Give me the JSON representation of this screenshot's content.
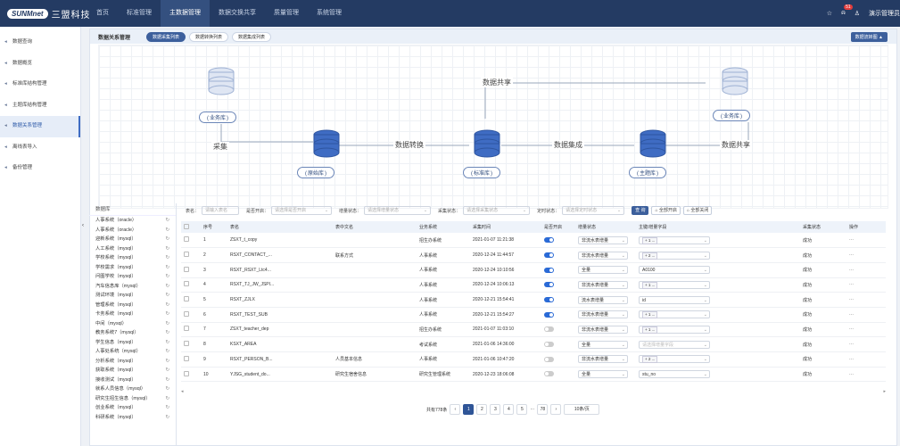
{
  "topbar": {
    "logo_mark": "SUNMnet",
    "logo_name": "三盟科技",
    "nav": [
      "首页",
      "标准管理",
      "主数据管理",
      "数据交换共享",
      "质量管理",
      "系统管理"
    ],
    "active": 2,
    "star_icon": "☆",
    "bell_icon": "🔔",
    "badge": "51",
    "user": "演示管理员"
  },
  "sidebar": {
    "items": [
      "数据查询",
      "数据概览",
      "标准库结构管理",
      "主题库结构管理",
      "数据关系管理",
      "离线表导入",
      "备份管理"
    ],
    "active": 4,
    "collapse": "‹"
  },
  "page": {
    "title": "数据关系管理",
    "tabs": [
      "数据采集列表",
      "数据转换列表",
      "数据集成列表"
    ],
    "active_tab": 0,
    "toggle": "数据流转图 ▲"
  },
  "diagram": {
    "nodes": {
      "biz_left": "业务库",
      "raw": "原始库",
      "std": "标准库",
      "topic": "主题库",
      "biz_right": "业务库"
    },
    "edges": {
      "collect": "采集",
      "convert": "数据转换",
      "share_top": "数据共享",
      "integrate": "数据集成",
      "share_right": "数据共享"
    }
  },
  "dblist": {
    "header": "数据库",
    "items": [
      "人事系统（oracle）",
      "人事系统（oracle）",
      "迎新系统（mysql）",
      "人工系统（mysql）",
      "学校系统（mysql）",
      "学校需求（mysql）",
      "问图学校（mysql）",
      "汽车信息库（mysql）",
      "测试环境（mysql）",
      "管理系统（mysql）",
      "卡务系统（mysql）",
      "中间（mysql）",
      "教务系统7（mysql）",
      "学生信息（mysql）",
      "人事处系统（mysql）",
      "分析系统（mysql）",
      "获取系统（mysql）",
      "接收测试（mysql）",
      "就系人员信息（mysql）",
      "研究生招生信息（mysql）",
      "创业系统（mysql）",
      "科研系统（mysql）"
    ]
  },
  "filters": {
    "table_label": "表名：",
    "table_ph": "请输入表名",
    "open_label": "是否开启：",
    "open_ph": "请选择是否开启",
    "sync_label": "增量状态：",
    "sync_ph": "请选择增量状态",
    "collect_label": "采集状态：",
    "collect_ph": "请选择采集状态",
    "timer_label": "定时状态：",
    "timer_ph": "请选择定时状态",
    "search": "查 询",
    "all_on": "全部开启",
    "all_off": "全部关闭"
  },
  "table": {
    "headers": [
      "序号",
      "表名",
      "表中文名",
      "业务系统",
      "采集时间",
      "是否开启",
      "增量状态",
      "主键/增量字段",
      "采集状态",
      "操作"
    ],
    "rows": [
      [
        "1",
        "ZSXT_t_copy",
        "",
        "招生办系统",
        "2021-01-07 11:21:38",
        true,
        "非流水表增量",
        "+ 1 ...",
        "成功",
        "⋯"
      ],
      [
        "2",
        "RSXT_CONTACT_...",
        "联系方式",
        "人事系统",
        "2020-12-24 11:44:57",
        true,
        "非流水表增量",
        "+ 2 ...",
        "成功",
        "⋯"
      ],
      [
        "3",
        "RSXT_RSXT_Ltc4...",
        "",
        "人事系统",
        "2020-12-24 10:10:56",
        true,
        "全量",
        "A0100",
        "成功",
        "⋯"
      ],
      [
        "4",
        "RSXT_TJ_JW_JSPI...",
        "",
        "人事系统",
        "2020-12-24 10:06:13",
        true,
        "非流水表增量",
        "+ 1 ...",
        "成功",
        "⋯"
      ],
      [
        "5",
        "RSXT_ZJLX",
        "",
        "人事系统",
        "2020-12-21 15:54:41",
        true,
        "流水表增量",
        "id",
        "成功",
        "⋯"
      ],
      [
        "6",
        "RSXT_TEST_SUB",
        "",
        "人事系统",
        "2020-12-21 15:54:27",
        true,
        "非流水表增量",
        "+ 1 ...",
        "成功",
        "⋯"
      ],
      [
        "7",
        "ZSXT_teacher_dep",
        "",
        "招生办系统",
        "2021-01-07 11:03:10",
        false,
        "非流水表增量",
        "+ 1 ...",
        "成功",
        "⋯"
      ],
      [
        "8",
        "KSXT_AREA",
        "",
        "考试系统",
        "2021-01-06 14:36:00",
        false,
        "全量",
        "请选择增量字段",
        "成功",
        "⋯"
      ],
      [
        "9",
        "RSXT_PERSON_B...",
        "人员基本信息",
        "人事系统",
        "2021-01-06 10:47:20",
        false,
        "非流水表增量",
        "+ 2 ...",
        "成功",
        "⋯"
      ],
      [
        "10",
        "YJSG_student_do...",
        "研究生宿舍信息",
        "研究生管理系统",
        "2020-12-23 18:06:08",
        false,
        "全量",
        "stu_no",
        "成功",
        "⋯"
      ]
    ]
  },
  "pagination": {
    "total": "共有778条",
    "pages": [
      "1",
      "2",
      "3",
      "4",
      "5",
      "···",
      "78"
    ],
    "prev": "‹",
    "next": "›",
    "size": "10条/页"
  }
}
